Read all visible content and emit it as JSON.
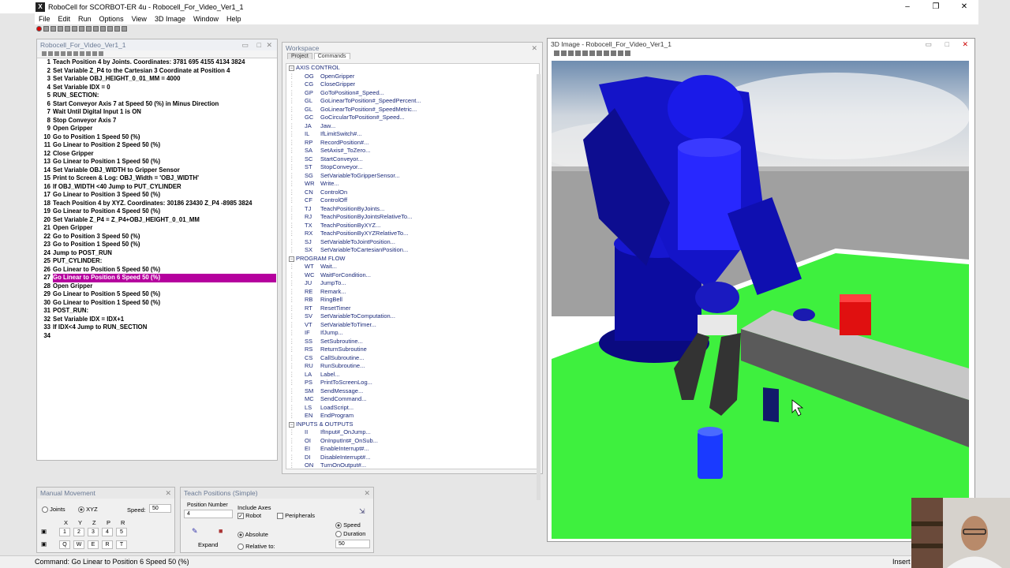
{
  "app": {
    "title": "RoboCell for SCORBOT-ER 4u - Robocell_For_Video_Ver1_1",
    "icon": "x-app-icon"
  },
  "window_controls": {
    "minimize": "–",
    "restore": "❐",
    "close": "✕"
  },
  "menu": [
    "File",
    "Edit",
    "Run",
    "Options",
    "View",
    "3D Image",
    "Window",
    "Help"
  ],
  "program_panel": {
    "title": "Robocell_For_Video_Ver1_1",
    "selected_line": 27,
    "lines": [
      {
        "n": "1",
        "text": "Teach Position 4 by Joints. Coordinates: 3781 695 4155 4134 3824"
      },
      {
        "n": "2",
        "text": "Set Variable Z_P4 to the Cartesian 3 Coordinate at Position 4"
      },
      {
        "n": "3",
        "text": "Set Variable OBJ_HEIGHT_0_01_MM  = 4000"
      },
      {
        "n": "4",
        "text": "Set Variable IDX  = 0"
      },
      {
        "n": "5",
        "text": "RUN_SECTION:"
      },
      {
        "n": "6",
        "text": "Start Conveyor Axis 7 at Speed 50 (%) in Minus Direction"
      },
      {
        "n": "7",
        "text": "Wait Until Digital Input 1 is ON"
      },
      {
        "n": "8",
        "text": "Stop Conveyor Axis 7"
      },
      {
        "n": "9",
        "text": "Open Gripper"
      },
      {
        "n": "10",
        "text": "Go to Position 1 Speed 50 (%)"
      },
      {
        "n": "11",
        "text": "Go Linear to Position 2 Speed 50 (%)"
      },
      {
        "n": "12",
        "text": "Close Gripper"
      },
      {
        "n": "13",
        "text": "Go Linear to Position 1 Speed 50 (%)"
      },
      {
        "n": "14",
        "text": "Set Variable OBJ_WIDTH to Gripper Sensor"
      },
      {
        "n": "15",
        "text": "Print to Screen & Log: OBJ_Width = 'OBJ_WIDTH'"
      },
      {
        "n": "16",
        "text": "If OBJ_WIDTH <40 Jump to PUT_CYLINDER"
      },
      {
        "n": "17",
        "text": "Go Linear to Position 3 Speed 50 (%)"
      },
      {
        "n": "18",
        "text": "Teach Position 4 by XYZ. Coordinates: 30186 23430 Z_P4 -8985 3824"
      },
      {
        "n": "19",
        "text": "Go Linear to Position 4 Speed 50 (%)"
      },
      {
        "n": "20",
        "text": "Set Variable Z_P4  = Z_P4+OBJ_HEIGHT_0_01_MM"
      },
      {
        "n": "21",
        "text": "Open Gripper"
      },
      {
        "n": "22",
        "text": "Go to Position 3 Speed 50 (%)"
      },
      {
        "n": "23",
        "text": "Go to Position 1 Speed 50 (%)"
      },
      {
        "n": "24",
        "text": "Jump to POST_RUN"
      },
      {
        "n": "25",
        "text": "PUT_CYLINDER:"
      },
      {
        "n": "26",
        "text": "Go Linear to Position 5 Speed 50 (%)"
      },
      {
        "n": "27",
        "text": "Go Linear to Position 6 Speed 50 (%)"
      },
      {
        "n": "28",
        "text": "Open Gripper"
      },
      {
        "n": "29",
        "text": "Go Linear to Position 5 Speed 50 (%)"
      },
      {
        "n": "30",
        "text": "Go Linear to Position 1 Speed 50 (%)"
      },
      {
        "n": "31",
        "text": "POST_RUN:"
      },
      {
        "n": "32",
        "text": "Set Variable IDX  = IDX+1"
      },
      {
        "n": "33",
        "text": "If IDX<4 Jump to RUN_SECTION"
      },
      {
        "n": "34",
        "text": ""
      }
    ]
  },
  "workspace": {
    "title": "Workspace",
    "tabs": [
      "Project",
      "Commands"
    ],
    "tree": [
      {
        "type": "group",
        "label": "AXIS CONTROL"
      },
      {
        "code": "OG",
        "label": "OpenGripper"
      },
      {
        "code": "CG",
        "label": "CloseGripper"
      },
      {
        "code": "GP",
        "label": "GoToPosition#_Speed..."
      },
      {
        "code": "GL",
        "label": "GoLinearToPosition#_SpeedPercent..."
      },
      {
        "code": "GL",
        "label": "GoLinearToPosition#_SpeedMetric..."
      },
      {
        "code": "GC",
        "label": "GoCircularToPosition#_Speed..."
      },
      {
        "code": "JA",
        "label": "Jaw..."
      },
      {
        "code": "IL",
        "label": "IfLimitSwitch#..."
      },
      {
        "code": "RP",
        "label": "RecordPosition#..."
      },
      {
        "code": "SA",
        "label": "SetAxis#_ToZero..."
      },
      {
        "code": "SC",
        "label": "StartConveyor..."
      },
      {
        "code": "ST",
        "label": "StopConveyor..."
      },
      {
        "code": "SG",
        "label": "SetVariableToGripperSensor..."
      },
      {
        "code": "WR",
        "label": "Write..."
      },
      {
        "code": "CN",
        "label": "ControlOn"
      },
      {
        "code": "CF",
        "label": "ControlOff"
      },
      {
        "code": "TJ",
        "label": "TeachPositionByJoints..."
      },
      {
        "code": "RJ",
        "label": "TeachPositionByJointsRelativeTo..."
      },
      {
        "code": "TX",
        "label": "TeachPositionByXYZ..."
      },
      {
        "code": "RX",
        "label": "TeachPositionByXYZRelativeTo..."
      },
      {
        "code": "SJ",
        "label": "SetVariableToJointPosition..."
      },
      {
        "code": "SX",
        "label": "SetVariableToCartesianPosition..."
      },
      {
        "type": "group",
        "label": "PROGRAM FLOW"
      },
      {
        "code": "WT",
        "label": "Wait..."
      },
      {
        "code": "WC",
        "label": "WaitForCondition..."
      },
      {
        "code": "JU",
        "label": "JumpTo..."
      },
      {
        "code": "RE",
        "label": "Remark..."
      },
      {
        "code": "RB",
        "label": "RingBell"
      },
      {
        "code": "RT",
        "label": "ResetTimer"
      },
      {
        "code": "SV",
        "label": "SetVariableToComputation..."
      },
      {
        "code": "VT",
        "label": "SetVariableToTimer..."
      },
      {
        "code": "IF",
        "label": "IfJump..."
      },
      {
        "code": "SS",
        "label": "SetSubroutine..."
      },
      {
        "code": "RS",
        "label": "ReturnSubroutine"
      },
      {
        "code": "CS",
        "label": "CallSubroutine..."
      },
      {
        "code": "RU",
        "label": "RunSubroutine..."
      },
      {
        "code": "LA",
        "label": "Label..."
      },
      {
        "code": "PS",
        "label": "PrintToScreenLog..."
      },
      {
        "code": "SM",
        "label": "SendMessage..."
      },
      {
        "code": "MC",
        "label": "SendCommand..."
      },
      {
        "code": "LS",
        "label": "LoadScript..."
      },
      {
        "code": "EN",
        "label": "EndProgram"
      },
      {
        "type": "group",
        "label": "INPUTS & OUTPUTS"
      },
      {
        "code": "II",
        "label": "IfInput#_OnJump..."
      },
      {
        "code": "OI",
        "label": "OnInputInt#_OnSub..."
      },
      {
        "code": "EI",
        "label": "EnableInterrupt#..."
      },
      {
        "code": "DI",
        "label": "DisableInterrupt#..."
      },
      {
        "code": "ON",
        "label": "TurnOnOutput#..."
      }
    ]
  },
  "view3d": {
    "title": "3D Image - Robocell_For_Video_Ver1_1"
  },
  "manual_movement": {
    "title": "Manual Movement",
    "mode_joints": "Joints",
    "mode_xyz": "XYZ",
    "speed_label": "Speed:",
    "speed_value": "50",
    "axis_labels": [
      "X",
      "Y",
      "Z",
      "P",
      "R"
    ],
    "row1": [
      "1",
      "2",
      "3",
      "4",
      "5"
    ],
    "row2": [
      "Q",
      "W",
      "E",
      "R",
      "T"
    ]
  },
  "teach_positions": {
    "title": "Teach Positions (Simple)",
    "position_number_label": "Position Number",
    "position_number": "4",
    "include_axes": "Include Axes",
    "robot": "Robot",
    "peripherals": "Peripherals",
    "absolute": "Absolute",
    "relative_to": "Relative to:",
    "speed": "Speed",
    "duration": "Duration",
    "speed_value": "50",
    "expand": "Expand"
  },
  "status": {
    "command": "Command:  Go Linear to Position 6 Speed 50 (%)",
    "mode": "Insert"
  },
  "colors": {
    "selection": "#b5009e",
    "robot": "#1010e0",
    "floor": "#3ef03e",
    "sky": "#8aa0b8",
    "red_block": "#e01010"
  }
}
